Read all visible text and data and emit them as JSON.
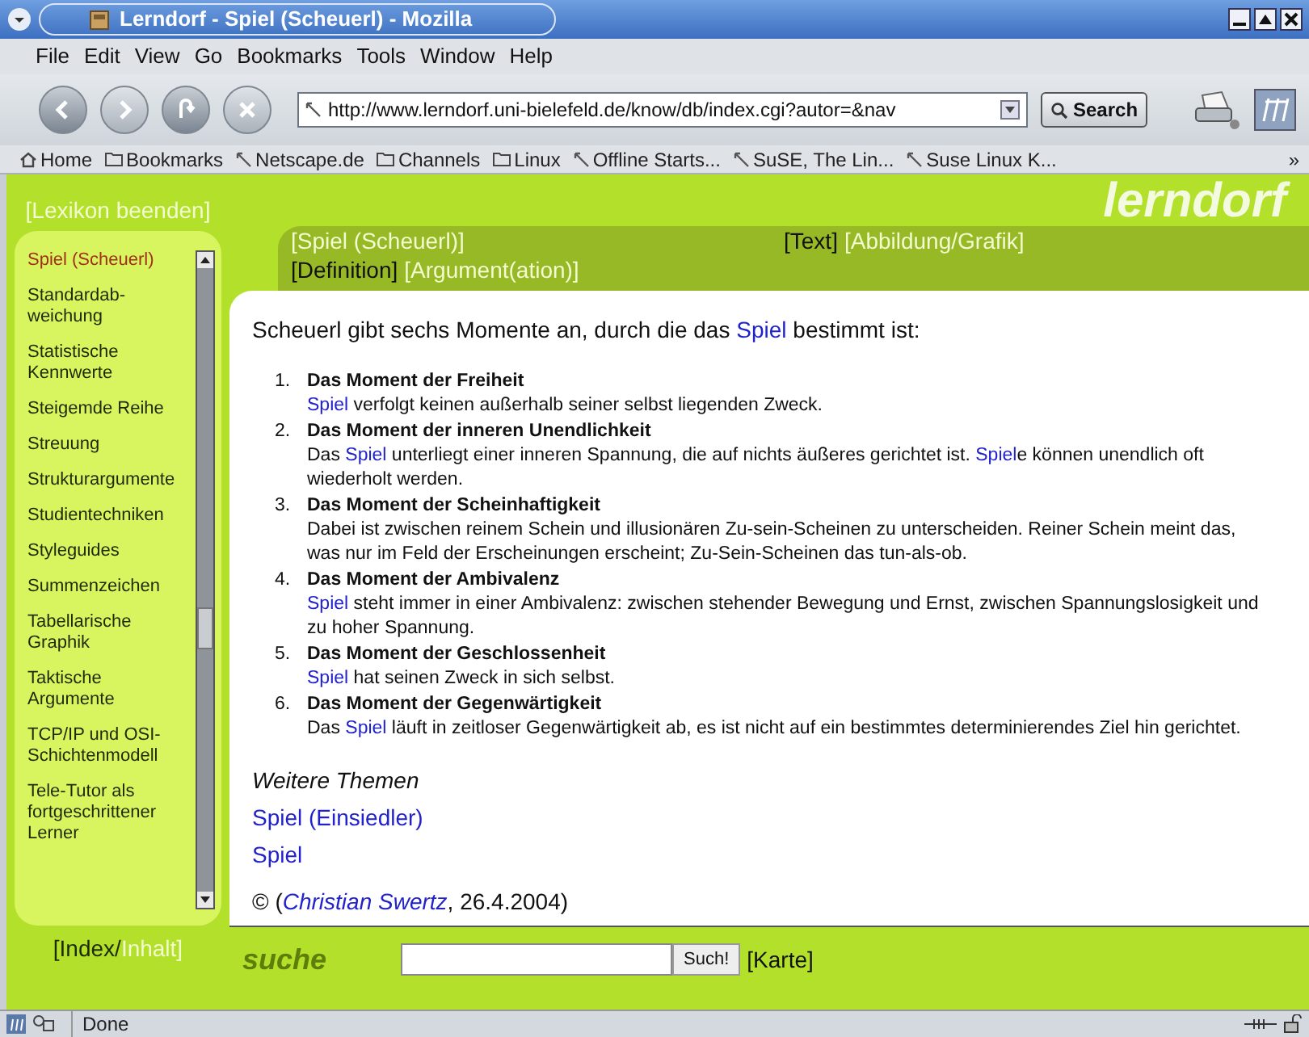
{
  "window": {
    "title": "Lerndorf - Spiel (Scheuerl) - Mozilla"
  },
  "menu": [
    "File",
    "Edit",
    "View",
    "Go",
    "Bookmarks",
    "Tools",
    "Window",
    "Help"
  ],
  "toolbar": {
    "url": "http://www.lerndorf.uni-bielefeld.de/know/db/index.cgi?autor=&nav",
    "search_button": "Search"
  },
  "bookmarks": [
    {
      "kind": "home",
      "label": "Home"
    },
    {
      "kind": "folder",
      "label": "Bookmarks"
    },
    {
      "kind": "link",
      "label": "Netscape.de"
    },
    {
      "kind": "folder",
      "label": "Channels"
    },
    {
      "kind": "folder",
      "label": "Linux"
    },
    {
      "kind": "link",
      "label": "Offline Starts..."
    },
    {
      "kind": "link",
      "label": "SuSE, The Lin..."
    },
    {
      "kind": "link",
      "label": "Suse Linux K..."
    }
  ],
  "bookmarks_overflow": "»",
  "page": {
    "logo": "lerndorf",
    "exit_link": "[Lexikon beenden]",
    "sidebar": [
      {
        "label": "Spiel (Scheuerl)",
        "selected": true
      },
      {
        "label": "Standardab-weichung",
        "selected": false
      },
      {
        "label": "Statistische Kennwerte",
        "selected": false
      },
      {
        "label": "Steigemde Reihe",
        "selected": false
      },
      {
        "label": "Streuung",
        "selected": false
      },
      {
        "label": "Strukturargumente",
        "selected": false
      },
      {
        "label": "Studientechniken",
        "selected": false
      },
      {
        "label": "Styleguides",
        "selected": false
      },
      {
        "label": "Summenzeichen",
        "selected": false
      },
      {
        "label": "Tabellarische Graphik",
        "selected": false
      },
      {
        "label": "Taktische Argumente",
        "selected": false
      },
      {
        "label": "TCP/IP und OSI-Schichtenmodell",
        "selected": false
      },
      {
        "label": "Tele-Tutor als fortgeschrittener Lerner",
        "selected": false
      }
    ],
    "index_links": [
      {
        "label": "[Index/",
        "selected": true
      },
      {
        "label": "Inhalt]",
        "selected": false
      }
    ],
    "topic_tab": "[Spiel (Scheuerl)]",
    "media_tabs": [
      {
        "label": "[Text]",
        "selected": true
      },
      {
        "label": "[Abbildung/Grafik]",
        "selected": false
      }
    ],
    "type_tabs": [
      {
        "label": "[Definition]",
        "selected": true
      },
      {
        "label": "[Argument(ation)]",
        "selected": false
      }
    ],
    "intro": [
      {
        "text": "Scheuerl gibt sechs Momente an, durch die das "
      },
      {
        "text": "Spiel",
        "link": true
      },
      {
        "text": " bestimmt ist:"
      }
    ],
    "moments": [
      {
        "number": "1.",
        "title": "Das Moment der Freiheit",
        "text": [
          {
            "text": "Spiel",
            "link": true
          },
          {
            "text": " verfolgt keinen außerhalb seiner selbst liegenden Zweck."
          }
        ]
      },
      {
        "number": "2.",
        "title": "Das Moment der inneren Unendlichkeit",
        "text": [
          {
            "text": "Das "
          },
          {
            "text": "Spiel",
            "link": true
          },
          {
            "text": " unterliegt einer inneren Spannung, die auf nichts äußeres gerichtet ist. "
          },
          {
            "text": "Spiel",
            "link": true
          },
          {
            "text": "e können unendlich oft wiederholt werden."
          }
        ]
      },
      {
        "number": "3.",
        "title": "Das Moment der Scheinhaftigkeit",
        "text": [
          {
            "text": "Dabei ist zwischen reinem Schein und illusionären Zu-sein-Scheinen zu unterscheiden. Reiner Schein meint das, was nur im Feld der Erscheinungen erscheint; Zu-Sein-Scheinen das tun-als-ob."
          }
        ]
      },
      {
        "number": "4.",
        "title": "Das Moment der Ambivalenz",
        "text": [
          {
            "text": "Spiel",
            "link": true
          },
          {
            "text": " steht immer in einer Ambivalenz: zwischen stehender Bewegung und Ernst, zwischen Spannungslosigkeit und zu hoher Spannung."
          }
        ]
      },
      {
        "number": "5.",
        "title": "Das Moment der Geschlossenheit",
        "text": [
          {
            "text": "Spiel",
            "link": true
          },
          {
            "text": " hat seinen Zweck in sich selbst."
          }
        ]
      },
      {
        "number": "6.",
        "title": "Das Moment der Gegenwärtigkeit",
        "text": [
          {
            "text": "Das "
          },
          {
            "text": "Spiel",
            "link": true
          },
          {
            "text": " läuft in zeitloser Gegenwärtigkeit ab, es ist nicht auf ein bestimmtes determinierendes Ziel hin gerichtet."
          }
        ]
      }
    ],
    "more_heading": "Weitere Themen",
    "more_links": [
      "Spiel (Einsiedler)",
      "Spiel"
    ],
    "copyright": [
      {
        "text": "© ("
      },
      {
        "text": "Christian Swertz",
        "link": true
      },
      {
        "text": ", 26.4.2004)"
      }
    ],
    "search_logo": "suche",
    "search_button": "Such!",
    "map_link": "[Karte]"
  },
  "status": "Done"
}
